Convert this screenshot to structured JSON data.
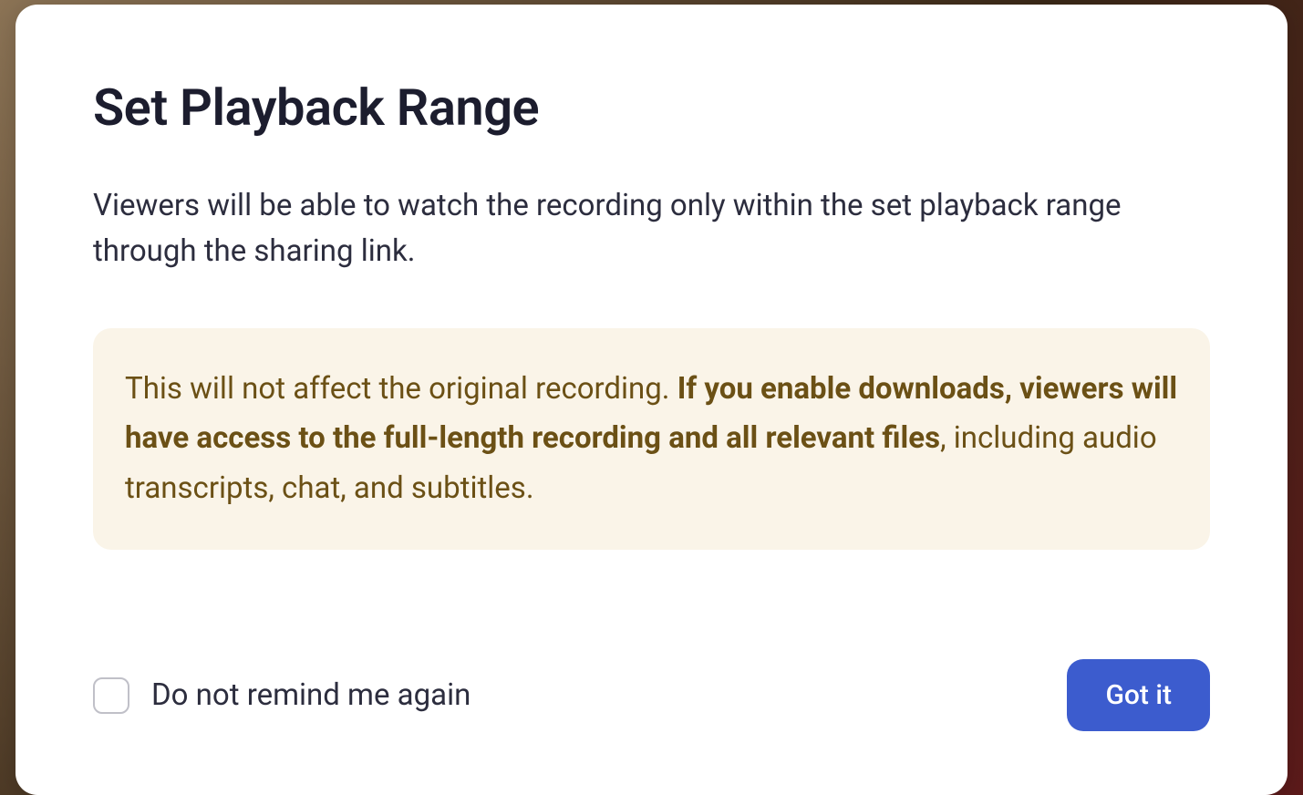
{
  "modal": {
    "title": "Set Playback Range",
    "description": "Viewers will be able to watch the recording only within the set playback range through the sharing link.",
    "notice": {
      "text_before": "This will not affect the original recording. ",
      "text_bold": "If you enable downloads, viewers will have access to the full-length recording and all relevant files",
      "text_after": ", including audio transcripts, chat, and subtitles."
    },
    "checkbox_label": "Do not remind me again",
    "confirm_button": "Got it"
  }
}
